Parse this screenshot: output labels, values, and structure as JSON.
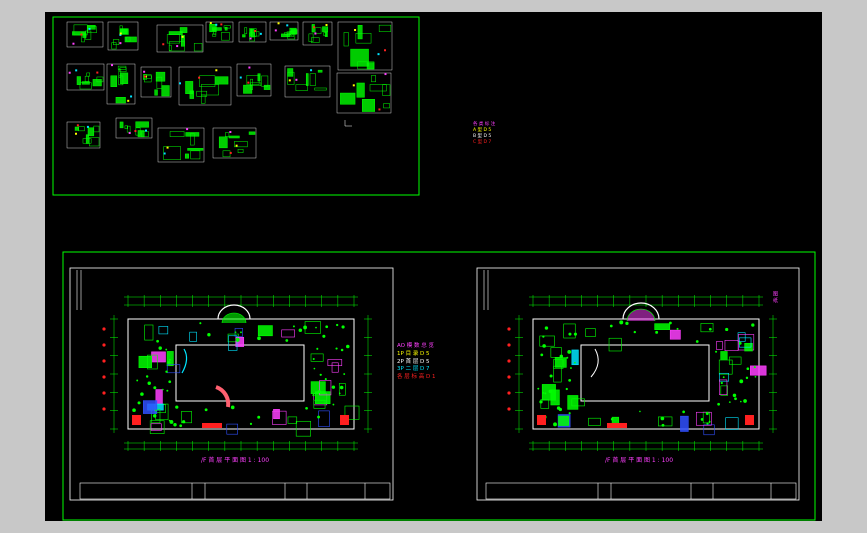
{
  "colors": {
    "bg": "#000000",
    "frame": "#00ff00",
    "line": "#00ff00",
    "accent_white": "#ffffff",
    "accent_cyan": "#00e5ff",
    "accent_blue": "#3050ff",
    "accent_red": "#ff2020",
    "accent_magenta": "#ff40ff",
    "accent_yellow": "#ffff00"
  },
  "legend_left": {
    "lines": [
      "AO 模 数 总 览",
      "1P 目 录 D 5",
      "2P 首 层 D 5",
      "3P 二 层 D 7",
      "各 层 标 高 D 1"
    ]
  },
  "legend_top": {
    "lines": [
      "各 类 标 注",
      "A 型 D 5",
      "B 型 D 5",
      "C 型 D 7"
    ]
  },
  "sheet_left": {
    "title": "/F 首 层 平 面 图 1 : 100"
  },
  "sheet_right": {
    "title": "/F 首 层 平 面 图 1 : 100",
    "side_note": "图 纸"
  }
}
